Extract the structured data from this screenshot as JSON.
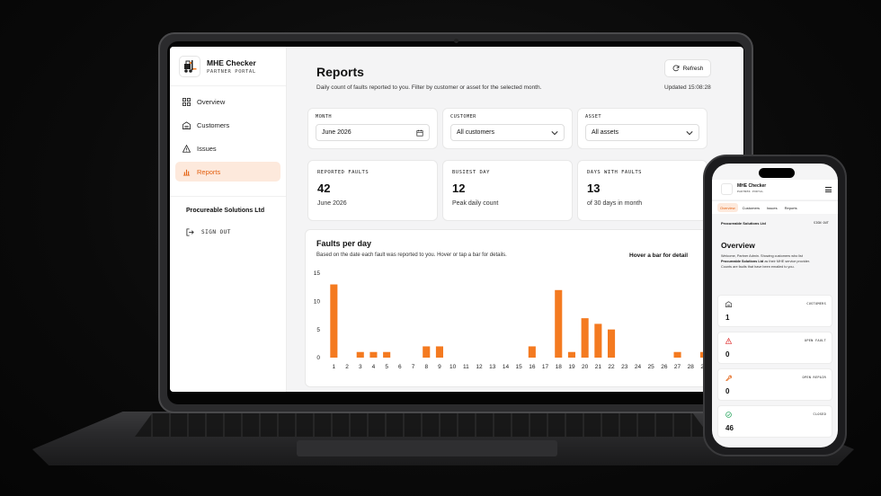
{
  "app": {
    "brand_title": "MHE Checker",
    "brand_subtitle": "PARTNER PORTAL"
  },
  "sidebar": {
    "items": [
      {
        "label": "Overview",
        "icon": "grid-icon"
      },
      {
        "label": "Customers",
        "icon": "warehouse-icon"
      },
      {
        "label": "Issues",
        "icon": "warning-icon"
      },
      {
        "label": "Reports",
        "icon": "bar-chart-icon",
        "active": true
      }
    ],
    "organization": "Procureable Solutions Ltd",
    "sign_out": "SIGN OUT"
  },
  "header": {
    "title": "Reports",
    "description": "Daily count of faults reported to you. Filter by customer or asset for the selected month.",
    "refresh_label": "Refresh",
    "updated": "Updated 15:08:28"
  },
  "filters": [
    {
      "label": "MONTH",
      "value": "June 2026",
      "icon": "calendar-icon"
    },
    {
      "label": "CUSTOMER",
      "value": "All customers",
      "icon": "chevron-down-icon"
    },
    {
      "label": "ASSET",
      "value": "All assets",
      "icon": "chevron-down-icon"
    }
  ],
  "stats": [
    {
      "label": "REPORTED FAULTS",
      "value": "42",
      "sub": "June 2026"
    },
    {
      "label": "BUSIEST DAY",
      "value": "12",
      "sub": "Peak daily count"
    },
    {
      "label": "DAYS WITH FAULTS",
      "value": "13",
      "sub": "of 30 days in month"
    }
  ],
  "chart": {
    "title": "Faults per day",
    "subtitle": "Based on the date each fault was reported to you. Hover or tap a bar for details.",
    "hint": "Hover a bar for detail"
  },
  "chart_data": {
    "type": "bar",
    "categories": [
      "1",
      "2",
      "3",
      "4",
      "5",
      "6",
      "7",
      "8",
      "9",
      "10",
      "11",
      "12",
      "13",
      "14",
      "15",
      "16",
      "17",
      "18",
      "19",
      "20",
      "21",
      "22",
      "23",
      "24",
      "25",
      "26",
      "27",
      "28",
      "29",
      "30"
    ],
    "values": [
      13,
      0,
      1,
      1,
      1,
      0,
      0,
      2,
      2,
      0,
      0,
      0,
      0,
      0,
      0,
      2,
      0,
      12,
      1,
      7,
      6,
      5,
      0,
      0,
      0,
      0,
      1,
      0,
      1,
      0
    ],
    "yticks": [
      0,
      5,
      10,
      15
    ],
    "ylim": [
      0,
      15
    ],
    "color": "#f47a20"
  },
  "phone": {
    "brand_title": "MHE Checker",
    "brand_subtitle": "PARTNER PORTAL",
    "tabs": [
      {
        "label": "Overview",
        "active": true
      },
      {
        "label": "Customers"
      },
      {
        "label": "Issues"
      },
      {
        "label": "Reports"
      }
    ],
    "organization": "Procureable Solutions Ltd",
    "sign_out": "SIGN OUT",
    "title": "Overview",
    "desc_line1": "Welcome, Partner Admin. Showing customers who list",
    "desc_bold": "Procureable Solutions Ltd",
    "desc_line2": " as their MHE service provider.",
    "desc_line3": "Counts are faults that have been emailed to you.",
    "cards": [
      {
        "label": "CUSTOMERS",
        "value": "1",
        "icon": "warehouse-icon",
        "color": "#444444"
      },
      {
        "label": "OPEN FAULT",
        "value": "0",
        "icon": "warning-icon",
        "color": "#e03434"
      },
      {
        "label": "OPEN REPAIR",
        "value": "0",
        "icon": "wrench-icon",
        "color": "#e35f0e"
      },
      {
        "label": "CLOSED",
        "value": "46",
        "icon": "check-circle-icon",
        "color": "#22a35a"
      }
    ]
  }
}
